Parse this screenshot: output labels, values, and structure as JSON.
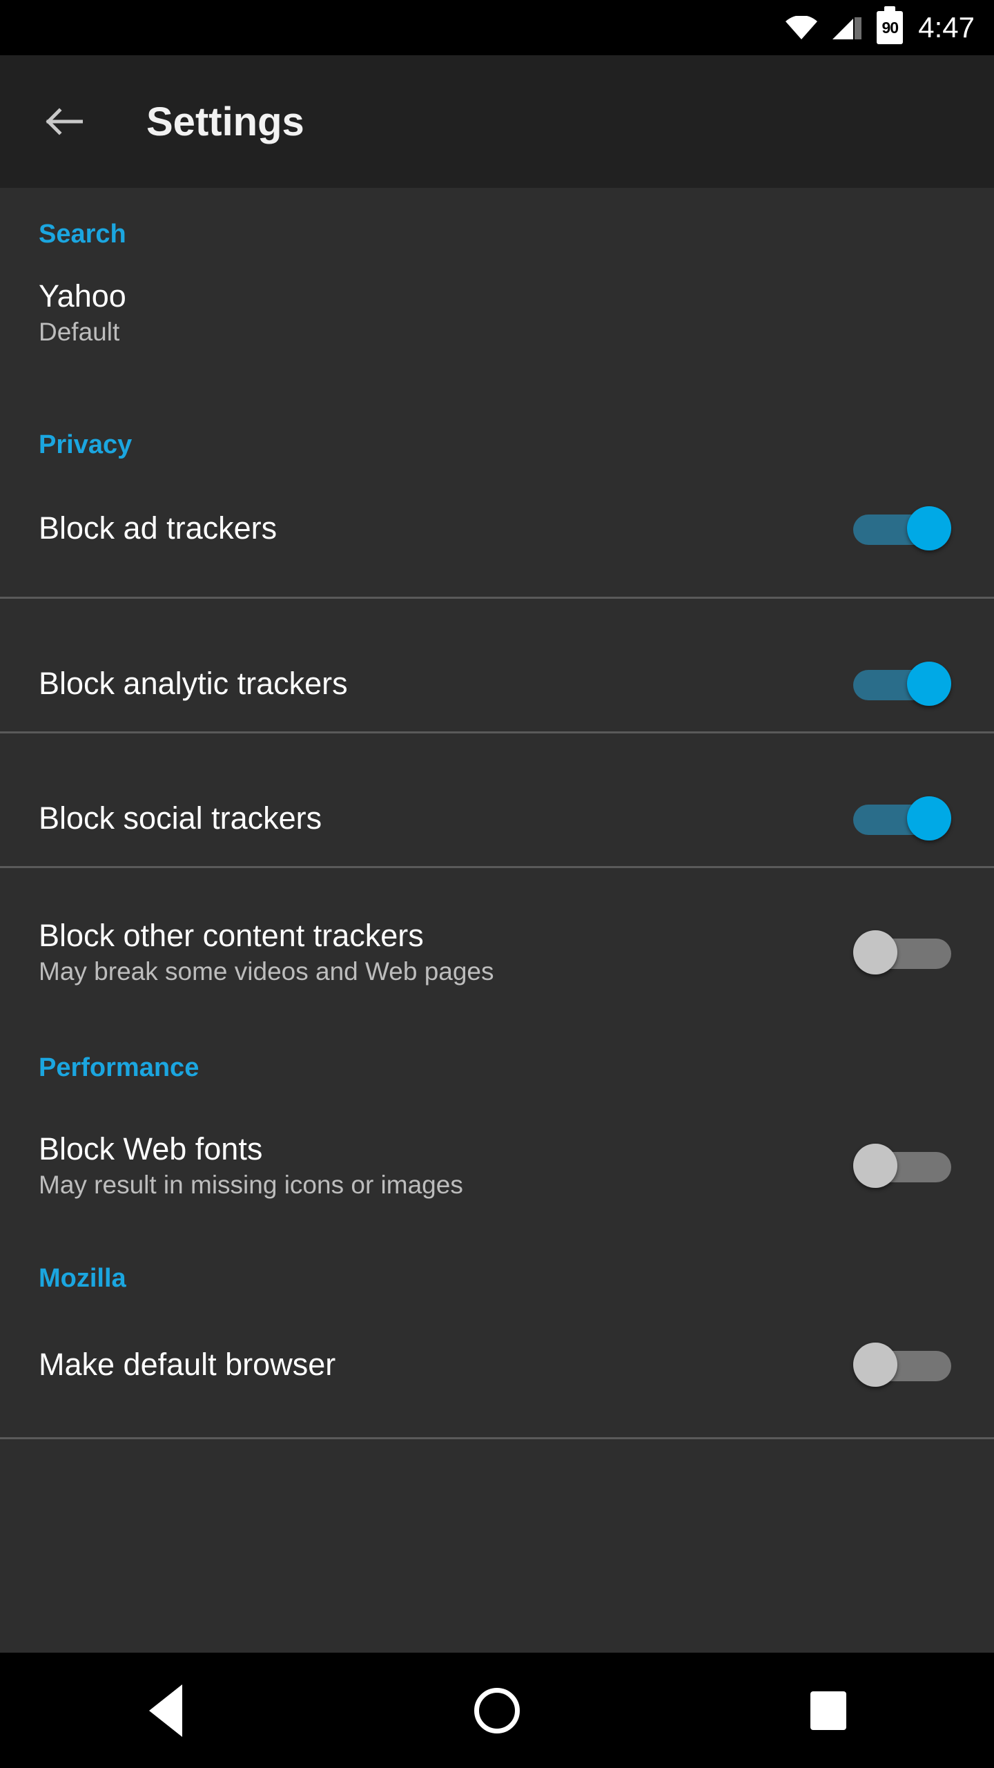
{
  "status_bar": {
    "wifi_icon": "wifi-icon",
    "signal_icon": "cellular-signal-icon",
    "battery_icon": "battery-icon",
    "battery_level": "90",
    "time": "4:47"
  },
  "header": {
    "back_icon": "back-arrow-icon",
    "title": "Settings"
  },
  "colors": {
    "accent": "#1ba6e0",
    "background": "#2e2e2e",
    "header_background": "#212121",
    "toggle_on_thumb": "#00a9e6",
    "toggle_on_track": "#2a6d8a",
    "toggle_off_thumb": "#c4c4c4",
    "toggle_off_track": "#757575",
    "divider": "#5a5a5a",
    "primary_text": "#ffffff",
    "secondary_text": "#bdbdbd"
  },
  "sections": [
    {
      "id": "search",
      "label": "Search",
      "rows": [
        {
          "id": "search-engine",
          "title": "Yahoo",
          "subtitle": "Default",
          "has_toggle": false
        }
      ]
    },
    {
      "id": "privacy",
      "label": "Privacy",
      "rows": [
        {
          "id": "block-ad-trackers",
          "title": "Block ad trackers",
          "subtitle": "",
          "has_toggle": true,
          "toggle_state": "on"
        },
        {
          "id": "block-analytic-trackers",
          "title": "Block analytic trackers",
          "subtitle": "",
          "has_toggle": true,
          "toggle_state": "on"
        },
        {
          "id": "block-social-trackers",
          "title": "Block social trackers",
          "subtitle": "",
          "has_toggle": true,
          "toggle_state": "on"
        },
        {
          "id": "block-other-content-trackers",
          "title": "Block other content trackers",
          "subtitle": "May break some videos and Web pages",
          "has_toggle": true,
          "toggle_state": "off"
        }
      ]
    },
    {
      "id": "performance",
      "label": "Performance",
      "rows": [
        {
          "id": "block-web-fonts",
          "title": "Block Web fonts",
          "subtitle": "May result in missing icons or images",
          "has_toggle": true,
          "toggle_state": "off"
        }
      ]
    },
    {
      "id": "mozilla",
      "label": "Mozilla",
      "rows": [
        {
          "id": "make-default-browser",
          "title": "Make default browser",
          "subtitle": "",
          "has_toggle": true,
          "toggle_state": "off"
        }
      ]
    }
  ],
  "nav_bar": {
    "back_icon": "nav-back-triangle-icon",
    "home_icon": "nav-home-circle-icon",
    "recent_icon": "nav-recent-apps-square-icon"
  }
}
